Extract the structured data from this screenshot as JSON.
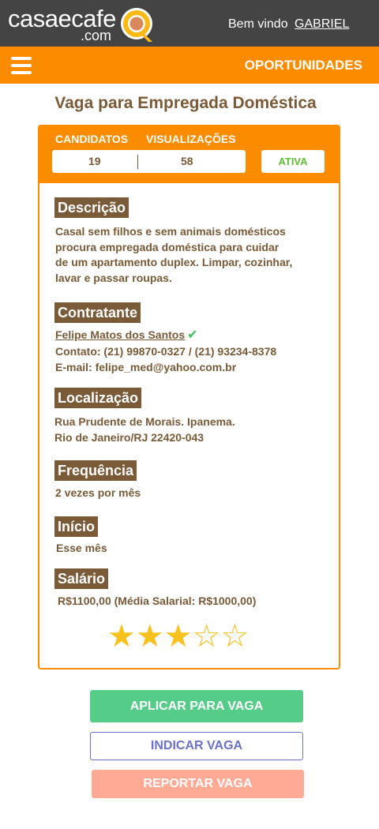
{
  "brand": {
    "name": "casaecafe",
    "suffix": ".com"
  },
  "header": {
    "welcome": "Bem vindo",
    "user": "GABRIEL"
  },
  "nav": {
    "title": "OPORTUNIDADES",
    "menu_icon": "hamburger-menu-icon"
  },
  "job": {
    "title": "Vaga para Empregada Doméstica",
    "stats": {
      "candidates_label": "CANDIDATOS",
      "views_label": "VISUALIZAÇÕES",
      "candidates": "19",
      "views": "58",
      "status": "ATIVA"
    },
    "description": {
      "heading": "Descrição",
      "lines": [
        "Casal sem filhos e sem animais domésticos",
        "procura empregada doméstica para cuidar",
        "de um apartamento duplex. Limpar, cozinhar,",
        "lavar e passar roupas."
      ]
    },
    "contractor": {
      "heading": "Contratante",
      "name": "Felipe Matos dos Santos",
      "contact": "Contato: (21) 99870-0327 / (21) 93234-8378",
      "email": "E-mail: felipe_med@yahoo.com.br"
    },
    "location": {
      "heading": "Localização",
      "line1": "Rua Prudente de Morais. Ipanema.",
      "line2": "Rio de Janeiro/RJ  22420-043"
    },
    "frequency": {
      "heading": "Frequência",
      "value": "2 vezes por mês"
    },
    "start": {
      "heading": "Início",
      "value": "Esse mês"
    },
    "salary": {
      "heading": "Salário",
      "value": "R$1100,00 (Média Salarial: R$1000,00)"
    },
    "rating": {
      "value": 3,
      "max": 5
    }
  },
  "actions": {
    "apply": "APLICAR PARA VAGA",
    "indicate": "INDICAR VAGA",
    "report": "REPORTAR VAGA"
  },
  "colors": {
    "orange": "#fb8c00",
    "brown": "#7a5a37",
    "green": "#55cc88",
    "blue": "#6a72c8",
    "salmon": "#ffaa94",
    "star": "#f8c21e"
  }
}
